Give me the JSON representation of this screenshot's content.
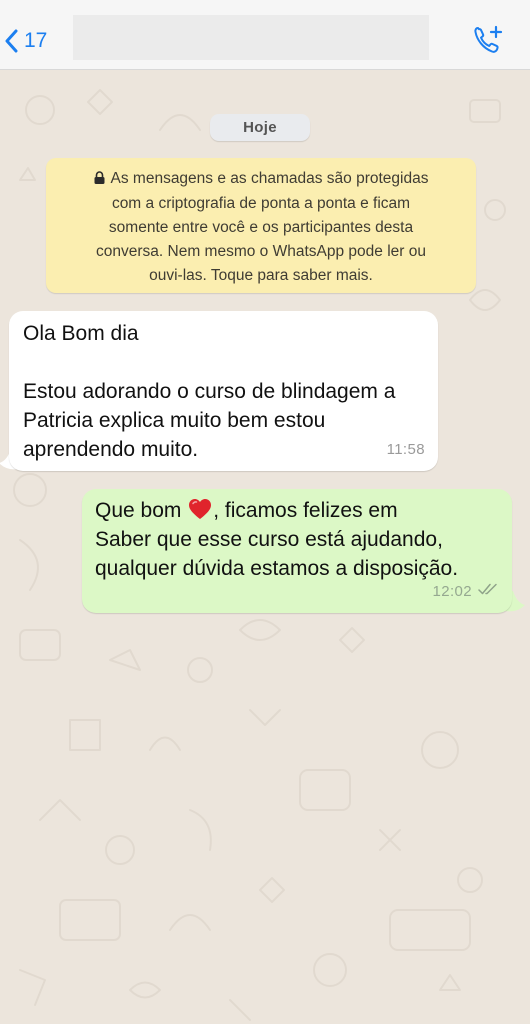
{
  "header": {
    "back_count": "17",
    "icons": {
      "back": "chevron-left-icon",
      "call": "add-call-icon"
    }
  },
  "date_chip": "Hoje",
  "encryption_notice": {
    "lines": [
      "As mensagens e as chamadas são protegidas",
      "com a criptografia de ponta a ponta e ficam",
      "somente entre você e os participantes desta",
      "conversa. Nem mesmo o WhatsApp pode ler ou",
      "ouvi-las. Toque para saber mais."
    ]
  },
  "messages": [
    {
      "direction": "incoming",
      "lines": [
        "Ola Bom dia",
        "",
        "Estou adorando o curso de blindagem a",
        "Patricia explica muito bem estou",
        "aprendendo muito."
      ],
      "time": "11:58"
    },
    {
      "direction": "outgoing",
      "line1_before": "Que bom ",
      "line1_after": ", ficamos felizes em",
      "lines": [
        "Saber que esse curso está ajudando,",
        "qualquer dúvida estamos a disposição."
      ],
      "time": "12:02",
      "status": "read-ticks-icon"
    }
  ],
  "colors": {
    "accent": "#1c7ff0",
    "outgoing_bubble": "#dcf8c6",
    "incoming_bubble": "#ffffff",
    "notice": "#fbeeb0",
    "chat_background": "#ece5dc"
  }
}
